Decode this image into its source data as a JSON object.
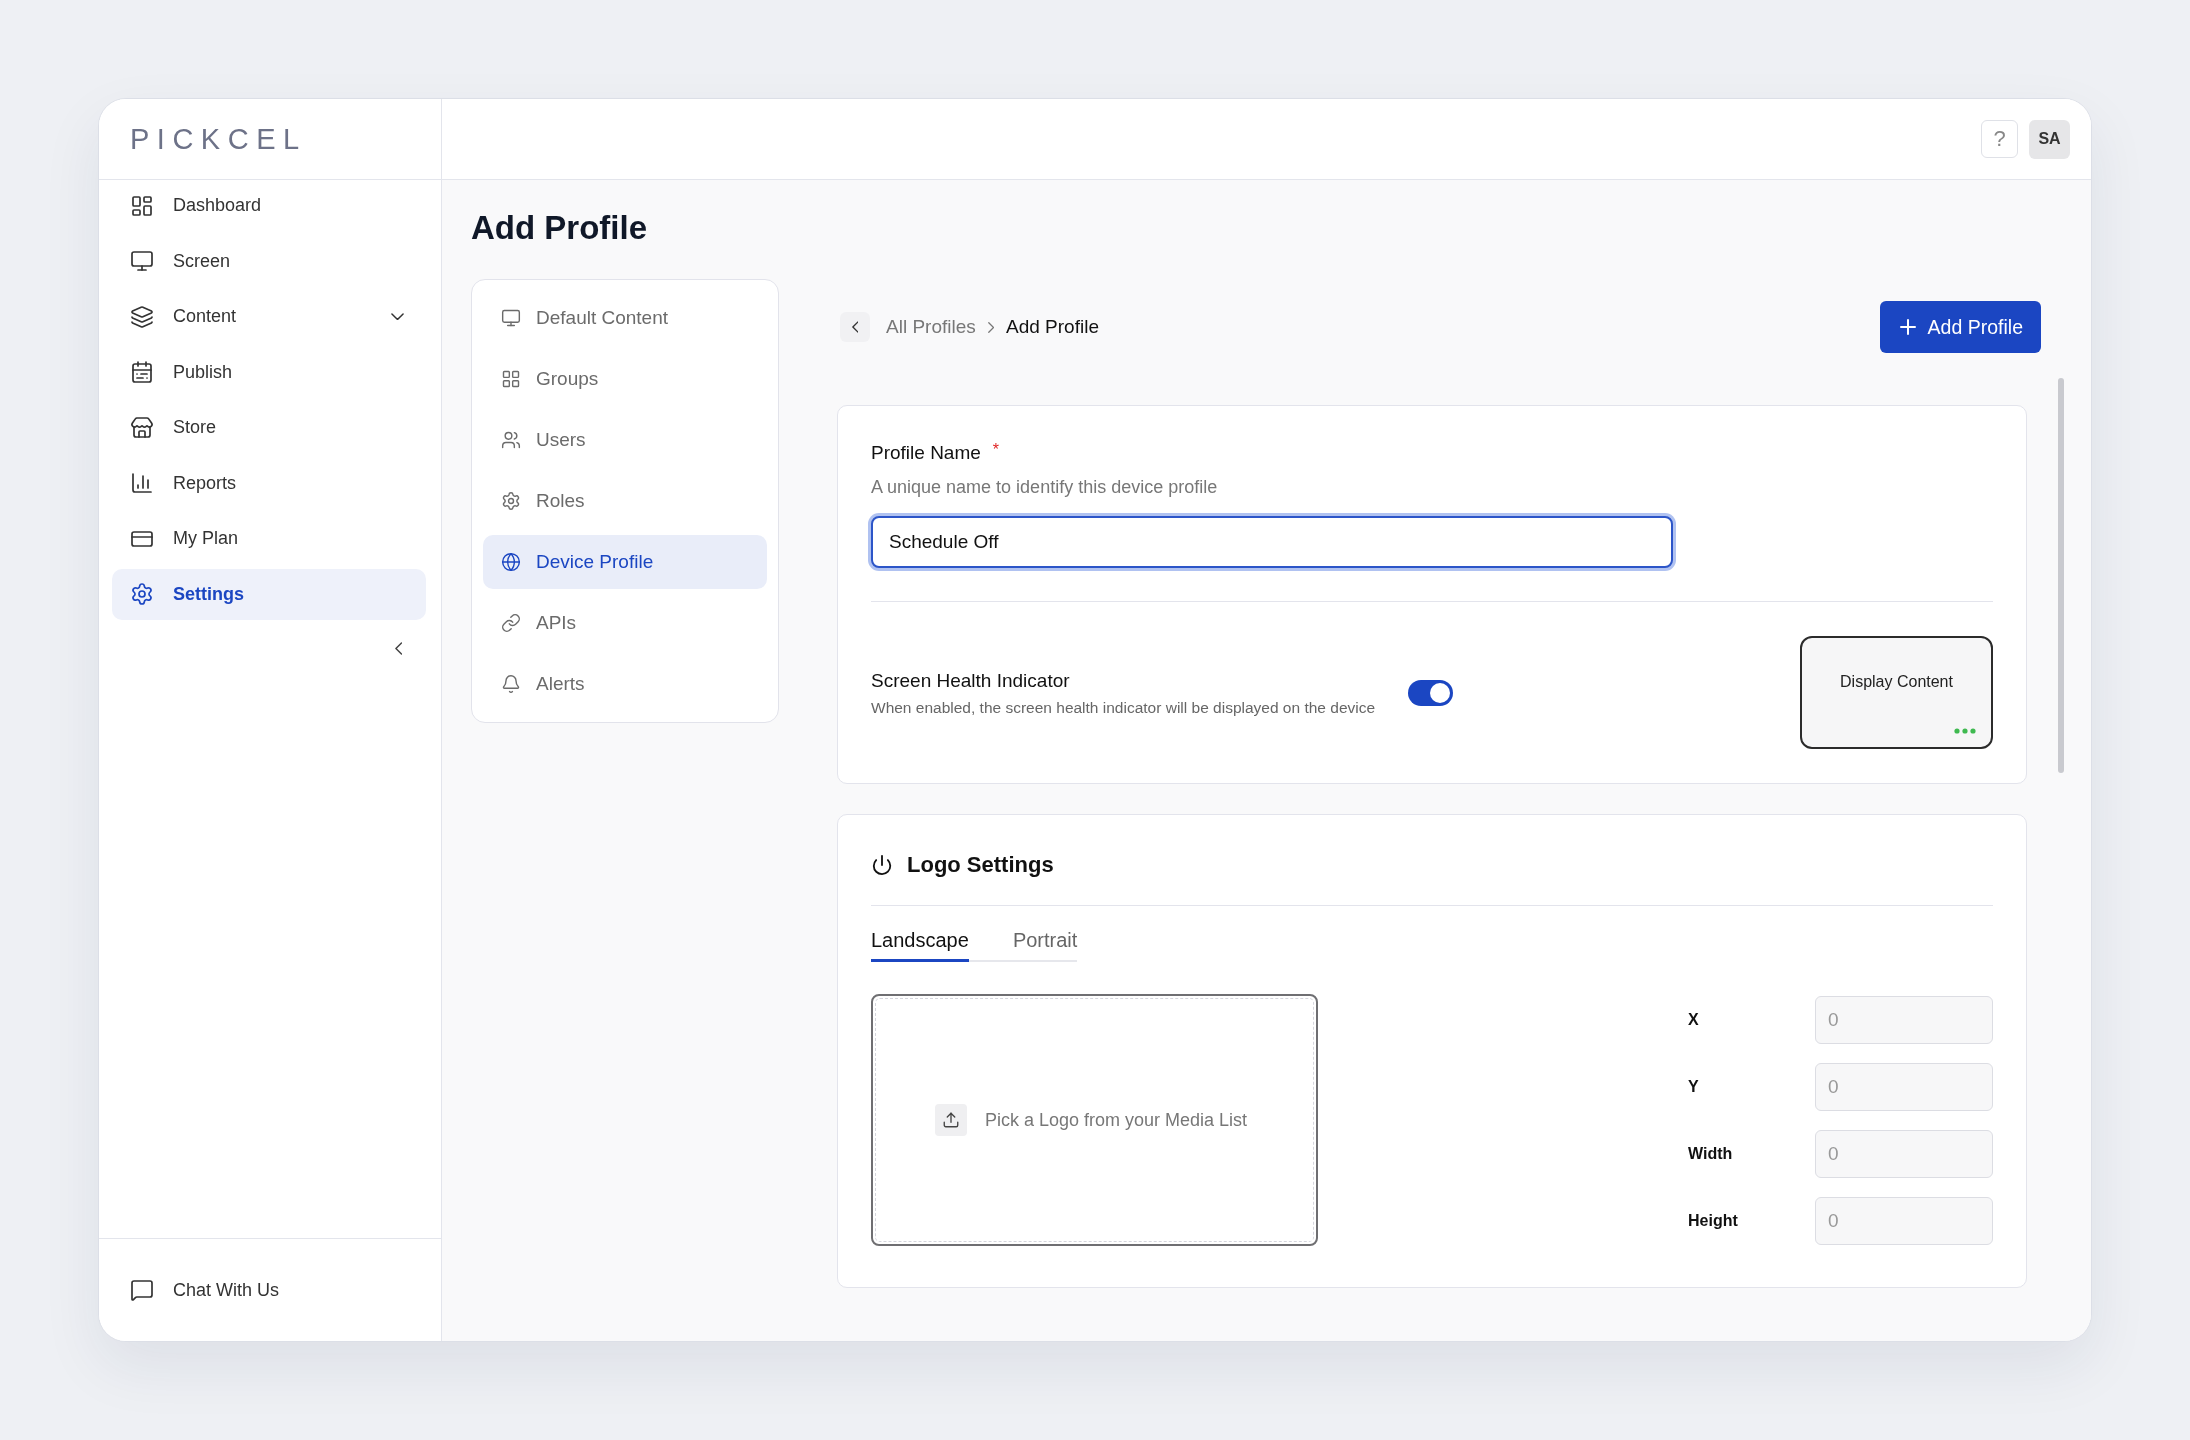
{
  "logo": "PICKCEL",
  "sidebar": {
    "items": [
      {
        "label": "Dashboard",
        "kind": "link",
        "selected": false
      },
      {
        "label": "Screen",
        "kind": "link",
        "selected": false
      },
      {
        "label": "Content",
        "kind": "group",
        "expanded": false,
        "selected": false
      },
      {
        "label": "Publish",
        "kind": "link",
        "selected": false
      },
      {
        "label": "Store",
        "kind": "link",
        "selected": false
      },
      {
        "label": "Reports",
        "kind": "link",
        "selected": false
      },
      {
        "label": "My Plan",
        "kind": "link",
        "selected": false
      },
      {
        "label": "Settings",
        "kind": "link",
        "selected": true
      }
    ],
    "footer_link": "Chat With Us"
  },
  "topbar": {
    "help": "?",
    "user_initials": "SA"
  },
  "page": {
    "title": "Add Profile"
  },
  "settings_nav": {
    "items": [
      {
        "label": "Default Content",
        "selected": false
      },
      {
        "label": "Groups",
        "selected": false
      },
      {
        "label": "Users",
        "selected": false
      },
      {
        "label": "Roles",
        "selected": false
      },
      {
        "label": "Device Profile",
        "selected": true
      },
      {
        "label": "APIs",
        "selected": false
      },
      {
        "label": "Alerts",
        "selected": false
      }
    ]
  },
  "breadcrumb": {
    "items": [
      {
        "label": "All Profiles",
        "current": false
      },
      {
        "label": "Add Profile",
        "current": true
      }
    ]
  },
  "add_button": {
    "label": "Add Profile"
  },
  "profile_name": {
    "label": "Profile Name",
    "required_mark": "*",
    "hint": "A unique name to identify this device profile",
    "value": "Schedule Off",
    "focused": true
  },
  "screen_health": {
    "title": "Screen Health Indicator",
    "description": "When enabled, the screen health indicator will be displayed on the device",
    "on": true,
    "preview_label": "Display Content"
  },
  "logo_settings": {
    "title": "Logo Settings",
    "tabs": [
      {
        "label": "Landscape",
        "selected": true
      },
      {
        "label": "Portrait",
        "selected": false
      }
    ],
    "upload_label": "Pick a Logo from your Media List",
    "fields": [
      {
        "label": "X",
        "placeholder": "0"
      },
      {
        "label": "Y",
        "placeholder": "0"
      },
      {
        "label": "Width",
        "placeholder": "0"
      },
      {
        "label": "Height",
        "placeholder": "0"
      }
    ]
  }
}
